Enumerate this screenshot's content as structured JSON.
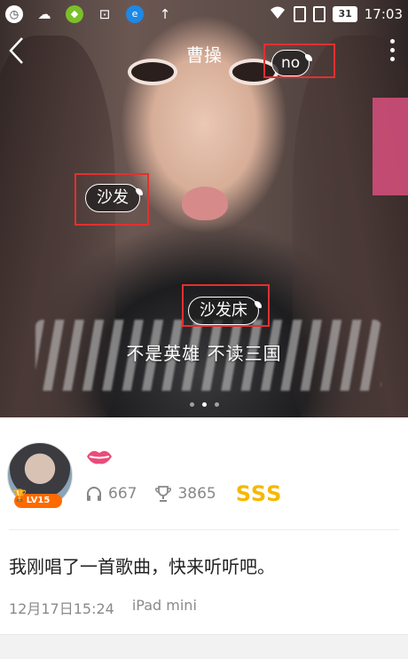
{
  "status_bar": {
    "time": "17:03",
    "battery": "31",
    "icons": [
      "clock-app-icon",
      "weather-icon",
      "green-app-icon",
      "screenshot-icon",
      "browser-icon",
      "upload-arrow-icon",
      "wifi-icon",
      "sim1-icon",
      "sim2-icon"
    ]
  },
  "header": {
    "title": "曹操",
    "back_icon": "chevron-left-icon",
    "more_icon": "more-vertical-icon"
  },
  "bubbles": [
    {
      "text": "no"
    },
    {
      "text": "沙发"
    },
    {
      "text": "沙发床"
    }
  ],
  "lyric": "不是英雄 不读三国",
  "carousel": {
    "count": 3,
    "active_index": 1
  },
  "profile": {
    "level": "LV15",
    "listens": "667",
    "trophies": "3865",
    "rating": "SSS"
  },
  "post": {
    "text": "我刚唱了一首歌曲，快来听听吧。",
    "date": "12月17日15:24",
    "device": "iPad mini"
  },
  "colors": {
    "highlight_box": "#e23030",
    "rating": "#f6b800",
    "level_badge": "#ff6a00"
  }
}
